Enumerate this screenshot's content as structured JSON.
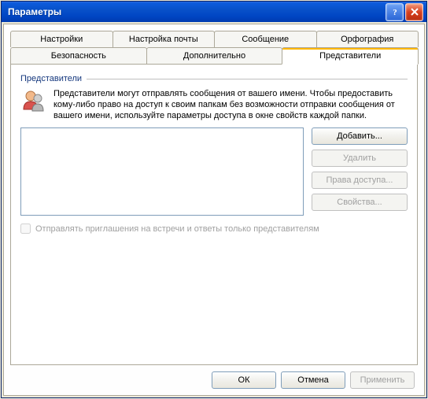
{
  "window": {
    "title": "Параметры"
  },
  "tabs": {
    "row1": [
      "Настройки",
      "Настройка почты",
      "Сообщение",
      "Орфография"
    ],
    "row2": [
      "Безопасность",
      "Дополнительно",
      "Представители"
    ],
    "active": "Представители"
  },
  "group": {
    "title": "Представители",
    "description": "Представители могут отправлять сообщения от вашего имени. Чтобы предоставить кому-либо право на доступ к своим папкам без возможности отправки сообщения от вашего имени, используйте параметры доступа в окне свойств каждой папки."
  },
  "buttons": {
    "add": "Добавить...",
    "remove": "Удалить",
    "rights": "Права доступа...",
    "props": "Свойства..."
  },
  "checkbox": {
    "label": "Отправлять приглашения на встречи и ответы только представителям"
  },
  "footer": {
    "ok": "ОК",
    "cancel": "Отмена",
    "apply": "Применить"
  }
}
